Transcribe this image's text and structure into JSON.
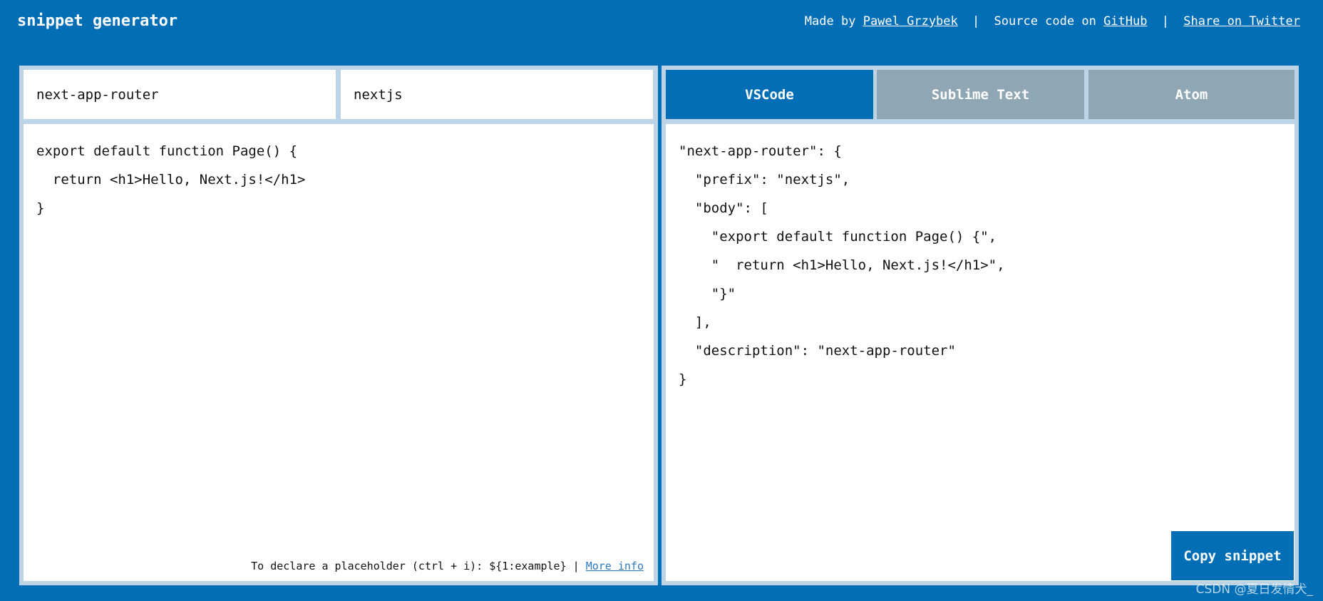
{
  "header": {
    "title": "snippet generator",
    "made_by_prefix": "Made by",
    "author_link": "Pawel Grzybek",
    "separator": "|",
    "source_prefix": "Source code on",
    "github_link": "GitHub",
    "twitter_link": "Share on Twitter"
  },
  "editor": {
    "name_value": "next-app-router",
    "prefix_value": "nextjs",
    "code_lines": [
      "export default function Page() {",
      "  return <h1>Hello, Next.js!</h1>",
      "}"
    ],
    "hint_text": "To declare a placeholder (ctrl + i): ${1:example} |",
    "more_info_link": "More info"
  },
  "output": {
    "tabs": [
      {
        "label": "VSCode",
        "active": true
      },
      {
        "label": "Sublime Text",
        "active": false
      },
      {
        "label": "Atom",
        "active": false
      }
    ],
    "snippet_lines": [
      "\"next-app-router\": {",
      "  \"prefix\": \"nextjs\",",
      "  \"body\": [",
      "    \"export default function Page() {\",",
      "    \"  return <h1>Hello, Next.js!</h1>\",",
      "    \"}\"",
      "  ],",
      "  \"description\": \"next-app-router\"",
      "}"
    ],
    "copy_label": "Copy snippet"
  },
  "watermark": "CSDN @夏日发情犬_",
  "colors": {
    "accent": "#026eb6",
    "tab_inactive": "#8fa6b4",
    "panel_border": "#bcd4e6"
  }
}
